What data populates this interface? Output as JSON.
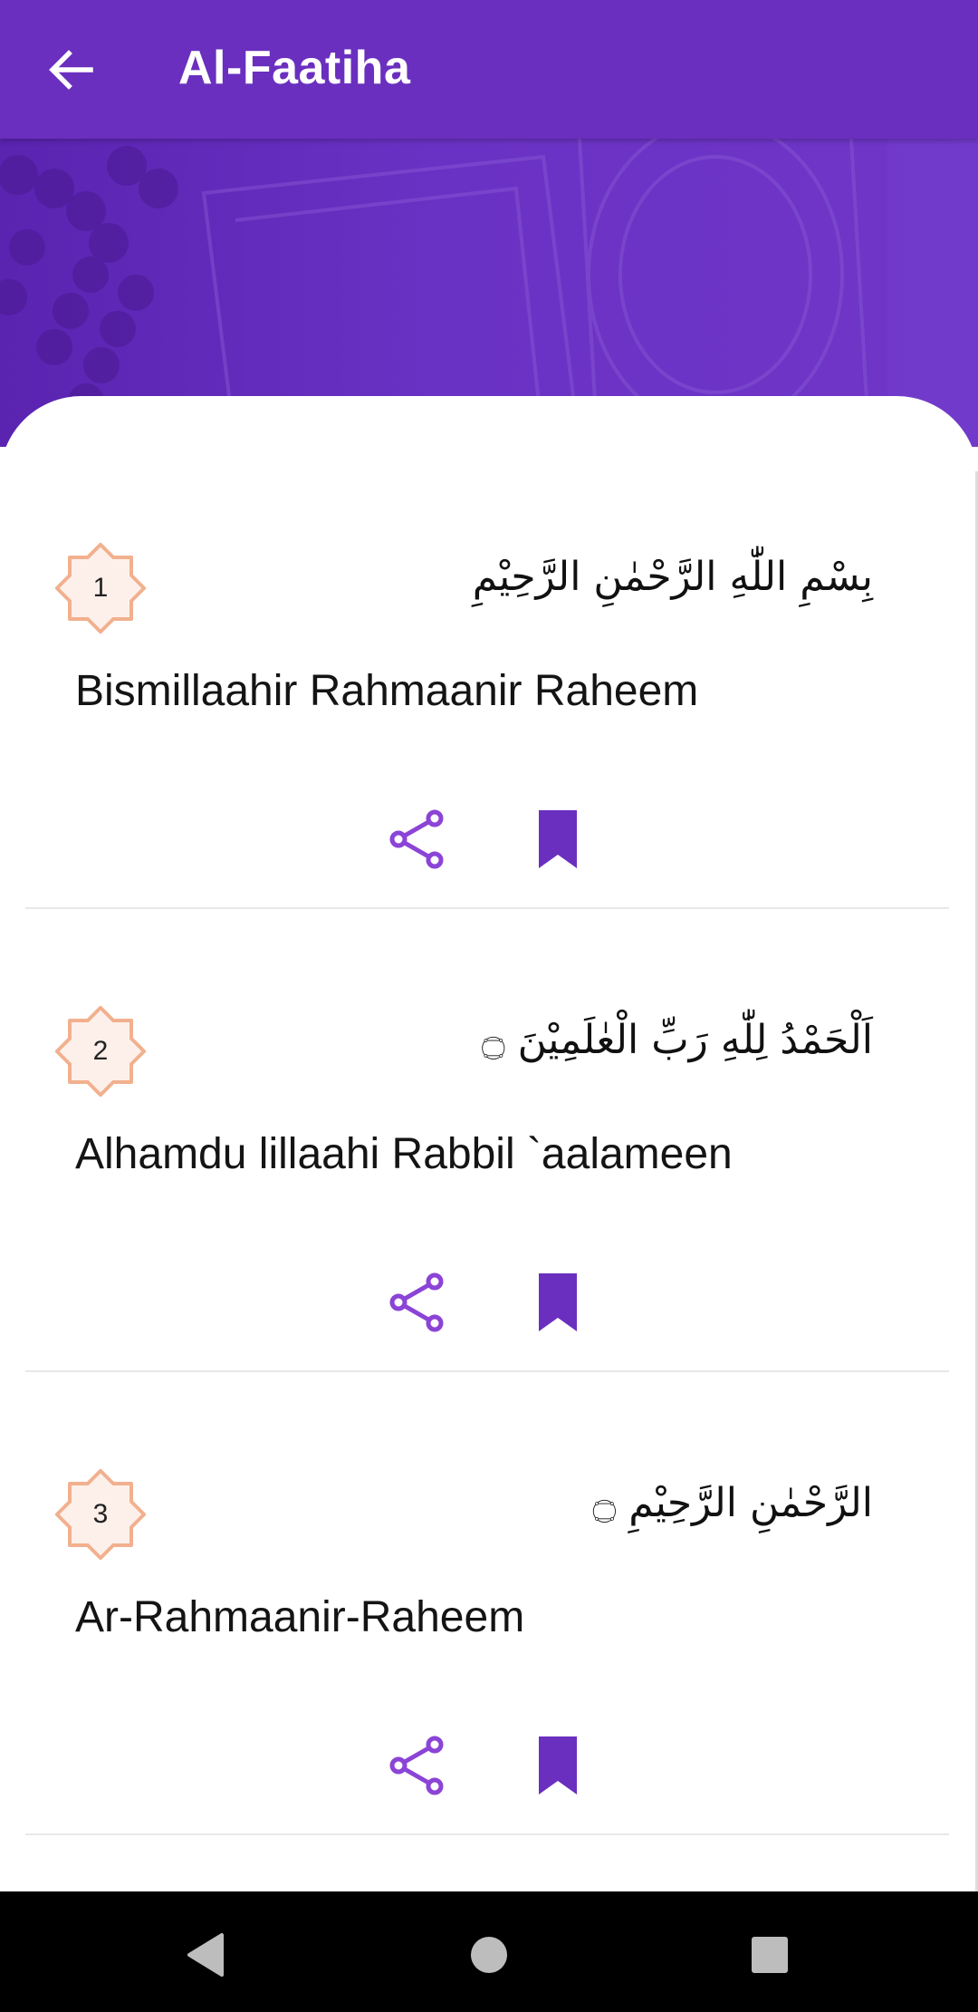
{
  "appbar": {
    "title": "Al-Faatiha"
  },
  "verses": [
    {
      "number": "1",
      "arabic": "بِسْمِ اللّٰهِ الرَّحْمٰنِ الرَّحِيْمِ",
      "transliteration": "Bismillaahir Rahmaanir Raheem"
    },
    {
      "number": "2",
      "arabic": "اَلْحَمْدُ لِلّٰهِ رَبِّ الْعٰلَمِيْنَ ۝",
      "transliteration": "Alhamdu lillaahi Rabbil `aalameen"
    },
    {
      "number": "3",
      "arabic": "الرَّحْمٰنِ الرَّحِيْمِ ۝",
      "transliteration": "Ar-Rahmaanir-Raheem"
    }
  ],
  "icons": {
    "back": "arrow-back-icon",
    "share": "share-icon",
    "bookmark": "bookmark-icon",
    "nav_back": "triangle-back-icon",
    "nav_home": "circle-home-icon",
    "nav_recents": "square-recents-icon"
  },
  "colors": {
    "primary": "#6a2fbf",
    "accent": "#8b44d6",
    "badge_stroke": "#f2b08e",
    "badge_fill": "#fdf0ea"
  }
}
